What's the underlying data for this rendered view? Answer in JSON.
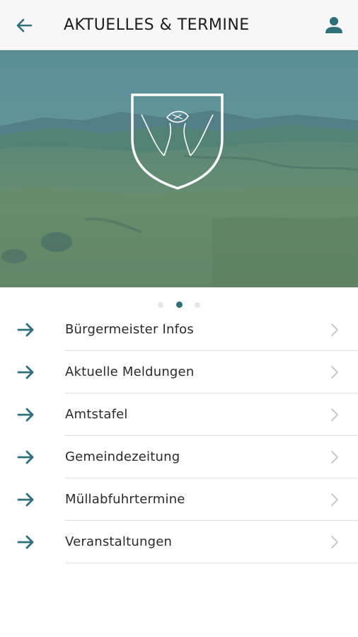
{
  "header": {
    "title": "AKTUELLES & TERMINE",
    "back_icon": "arrow-left-icon",
    "profile_icon": "person-icon"
  },
  "hero": {
    "logo": "shield-handshake-emblem"
  },
  "pager": {
    "count": 3,
    "active_index": 1
  },
  "menu": {
    "items": [
      {
        "label": "Bürgermeister Infos"
      },
      {
        "label": "Aktuelle Meldungen"
      },
      {
        "label": "Amtstafel"
      },
      {
        "label": "Gemeindezeitung"
      },
      {
        "label": "Müllabfuhrtermine"
      },
      {
        "label": "Veranstaltungen"
      }
    ]
  },
  "colors": {
    "accent": "#2f6f78",
    "appbar_bg": "#f7f7f7",
    "hero_tint": "#4e8a8f"
  }
}
